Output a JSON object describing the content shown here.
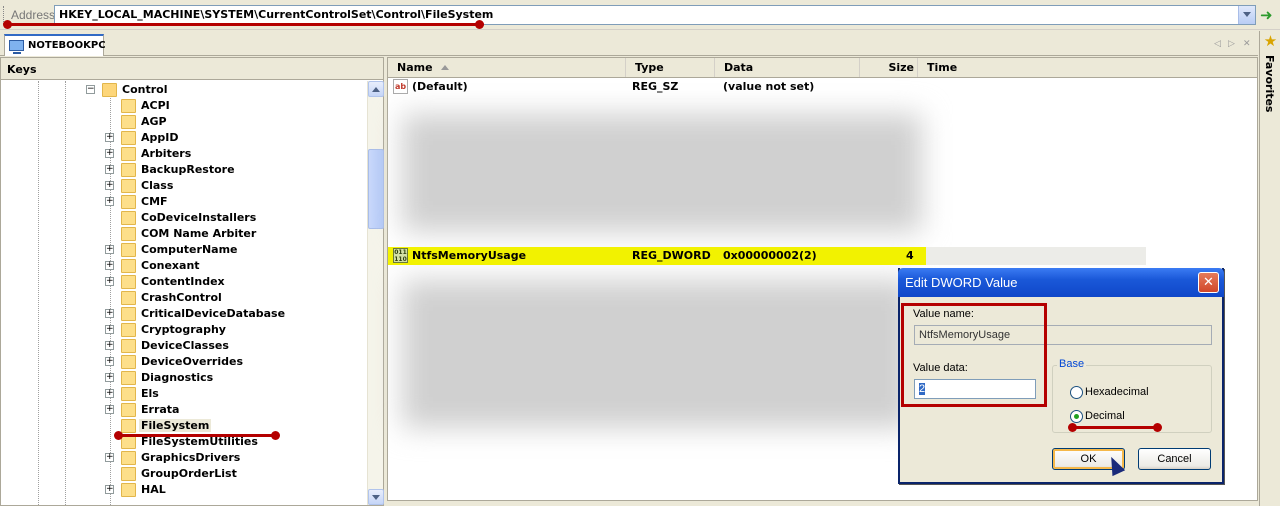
{
  "address": {
    "label": "Address",
    "path": "HKEY_LOCAL_MACHINE\\SYSTEM\\CurrentControlSet\\Control\\FileSystem"
  },
  "tab": {
    "label": "NOTEBOOKPC"
  },
  "favorites": {
    "label": "Favorites"
  },
  "keys_panel": {
    "title": "Keys",
    "parent": "Control",
    "items": [
      {
        "label": "ACPI",
        "expandable": false
      },
      {
        "label": "AGP",
        "expandable": false
      },
      {
        "label": "AppID",
        "expandable": true
      },
      {
        "label": "Arbiters",
        "expandable": true
      },
      {
        "label": "BackupRestore",
        "expandable": true
      },
      {
        "label": "Class",
        "expandable": true
      },
      {
        "label": "CMF",
        "expandable": true
      },
      {
        "label": "CoDeviceInstallers",
        "expandable": false
      },
      {
        "label": "COM Name Arbiter",
        "expandable": false
      },
      {
        "label": "ComputerName",
        "expandable": true
      },
      {
        "label": "Conexant",
        "expandable": true
      },
      {
        "label": "ContentIndex",
        "expandable": true
      },
      {
        "label": "CrashControl",
        "expandable": false
      },
      {
        "label": "CriticalDeviceDatabase",
        "expandable": true
      },
      {
        "label": "Cryptography",
        "expandable": true
      },
      {
        "label": "DeviceClasses",
        "expandable": true
      },
      {
        "label": "DeviceOverrides",
        "expandable": true
      },
      {
        "label": "Diagnostics",
        "expandable": true
      },
      {
        "label": "Els",
        "expandable": true
      },
      {
        "label": "Errata",
        "expandable": true
      },
      {
        "label": "FileSystem",
        "expandable": false,
        "selected": true
      },
      {
        "label": "FileSystemUtilities",
        "expandable": false
      },
      {
        "label": "GraphicsDrivers",
        "expandable": true
      },
      {
        "label": "GroupOrderList",
        "expandable": false
      },
      {
        "label": "HAL",
        "expandable": true
      }
    ]
  },
  "values_panel": {
    "columns": [
      "Name",
      "Type",
      "Data",
      "Size",
      "Time"
    ],
    "rows": [
      {
        "name": "(Default)",
        "type": "REG_SZ",
        "data": "(value not set)",
        "size": ""
      },
      {
        "name": "NtfsMemoryUsage",
        "type": "REG_DWORD",
        "data": "0x00000002(2)",
        "size": "4"
      }
    ]
  },
  "dialog": {
    "title": "Edit DWORD Value",
    "close_label": "✕",
    "value_name_label": "Value name:",
    "value_name": "NtfsMemoryUsage",
    "value_data_label": "Value data:",
    "value_data": "2",
    "base_label": "Base",
    "hex_label": "Hexadecimal",
    "dec_label": "Decimal",
    "base_selected": "Decimal",
    "ok_label": "OK",
    "cancel_label": "Cancel"
  },
  "icons": {
    "go": "go-arrow-icon",
    "favorites": "star-icon",
    "string_value": "string-value-icon",
    "binary_value": "dword-value-icon"
  },
  "colors": {
    "annotation": "#b40000",
    "highlight": "#f2f200",
    "titlebar": "#1a58d8"
  }
}
